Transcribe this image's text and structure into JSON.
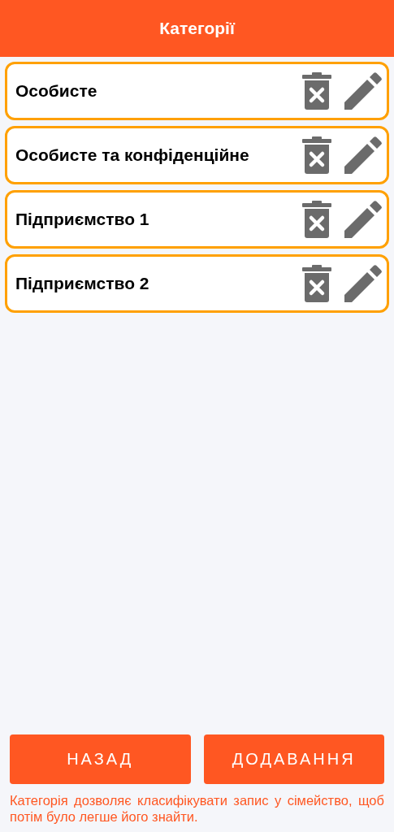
{
  "header": {
    "title": "Категорії"
  },
  "categories": [
    {
      "name": "Особисте"
    },
    {
      "name": "Особисте та конфіденційне"
    },
    {
      "name": "Підприємство 1"
    },
    {
      "name": "Підприємство 2"
    }
  ],
  "buttons": [
    {
      "label": "НАЗАД"
    },
    {
      "label": "ДОДАВАННЯ"
    }
  ],
  "hint": "Категорія дозволяє класифікувати запис у сімейство, щоб потім було легше його знайти."
}
